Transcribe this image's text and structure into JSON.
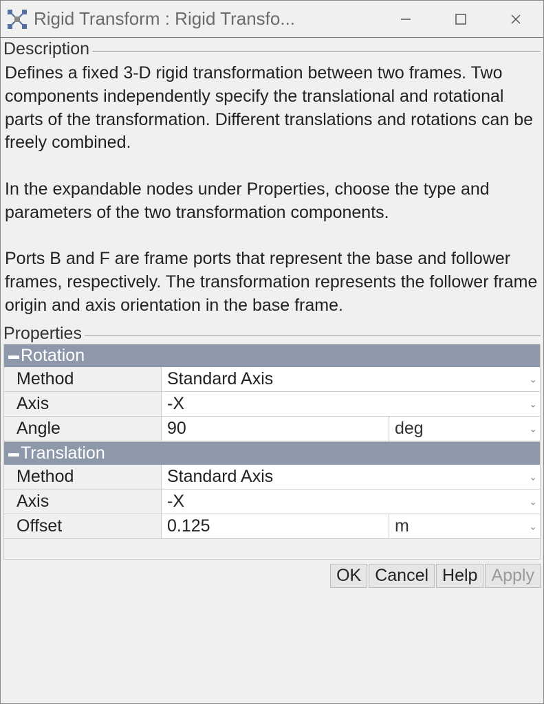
{
  "window": {
    "title": "Rigid Transform : Rigid Transfo..."
  },
  "description": {
    "label": "Description",
    "text": "Defines a fixed 3-D rigid transformation between two frames. Two components independently specify the translational and rotational parts of the transformation. Different translations and rotations can be freely combined.\n\nIn the expandable nodes under Properties, choose the type and parameters of the two transformation components.\n\nPorts B and F are frame ports that represent the base and follower frames, respectively. The transformation represents the follower frame origin and axis orientation in the base frame."
  },
  "properties": {
    "label": "Properties",
    "rotation": {
      "header": "Rotation",
      "method_label": "Method",
      "method_value": "Standard Axis",
      "axis_label": "Axis",
      "axis_value": "-X",
      "angle_label": "Angle",
      "angle_value": "90",
      "angle_unit": "deg"
    },
    "translation": {
      "header": "Translation",
      "method_label": "Method",
      "method_value": "Standard Axis",
      "axis_label": "Axis",
      "axis_value": "-X",
      "offset_label": "Offset",
      "offset_value": "0.125",
      "offset_unit": "m"
    }
  },
  "buttons": {
    "ok": "OK",
    "cancel": "Cancel",
    "help": "Help",
    "apply": "Apply"
  }
}
